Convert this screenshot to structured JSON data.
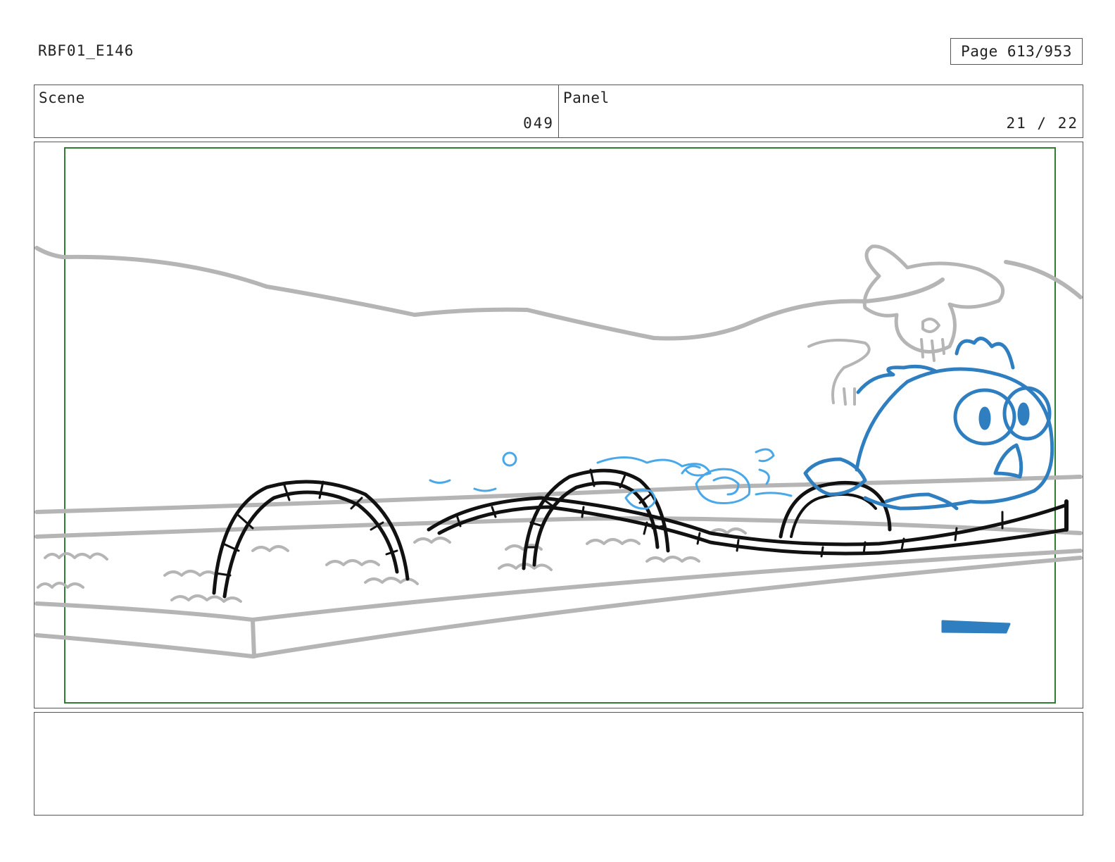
{
  "header": {
    "project_id": "RBF01_E146",
    "page_label": "Page 613/953"
  },
  "info": {
    "scene_label": "Scene",
    "scene_value": "049",
    "panel_label": "Panel",
    "panel_value": "21 / 22"
  },
  "drawing": {
    "colors": {
      "safe_frame": "#2e7d32",
      "rough": "#b5b5b5",
      "ink": "#111111",
      "character_blue": "#2f7fc0",
      "splash_blue": "#4aa8e8"
    }
  },
  "notes": {
    "text": ""
  }
}
